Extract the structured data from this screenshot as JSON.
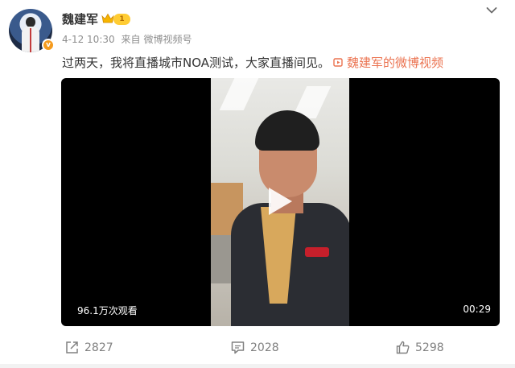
{
  "user": {
    "name": "魏建军",
    "level": "1",
    "verified_mark": "v"
  },
  "meta": {
    "date": "4-12 10:30",
    "source_prefix": "来自",
    "source": "微博视频号"
  },
  "post": {
    "text": "过两天，我将直播城市NOA测试，大家直播间见。",
    "link": "魏建军的微博视频"
  },
  "video": {
    "views": "96.1万次观看",
    "duration": "00:29"
  },
  "actions": {
    "share_count": "2827",
    "comment_count": "2028",
    "like_count": "5298"
  },
  "colors": {
    "link": "#eb7350",
    "accent_badge": "#ffcc33",
    "verified": "#f59b1e"
  },
  "icons": [
    "crown-icon",
    "chevron-down-icon",
    "video-link-icon",
    "play-icon",
    "share-icon",
    "comment-icon",
    "like-icon"
  ]
}
